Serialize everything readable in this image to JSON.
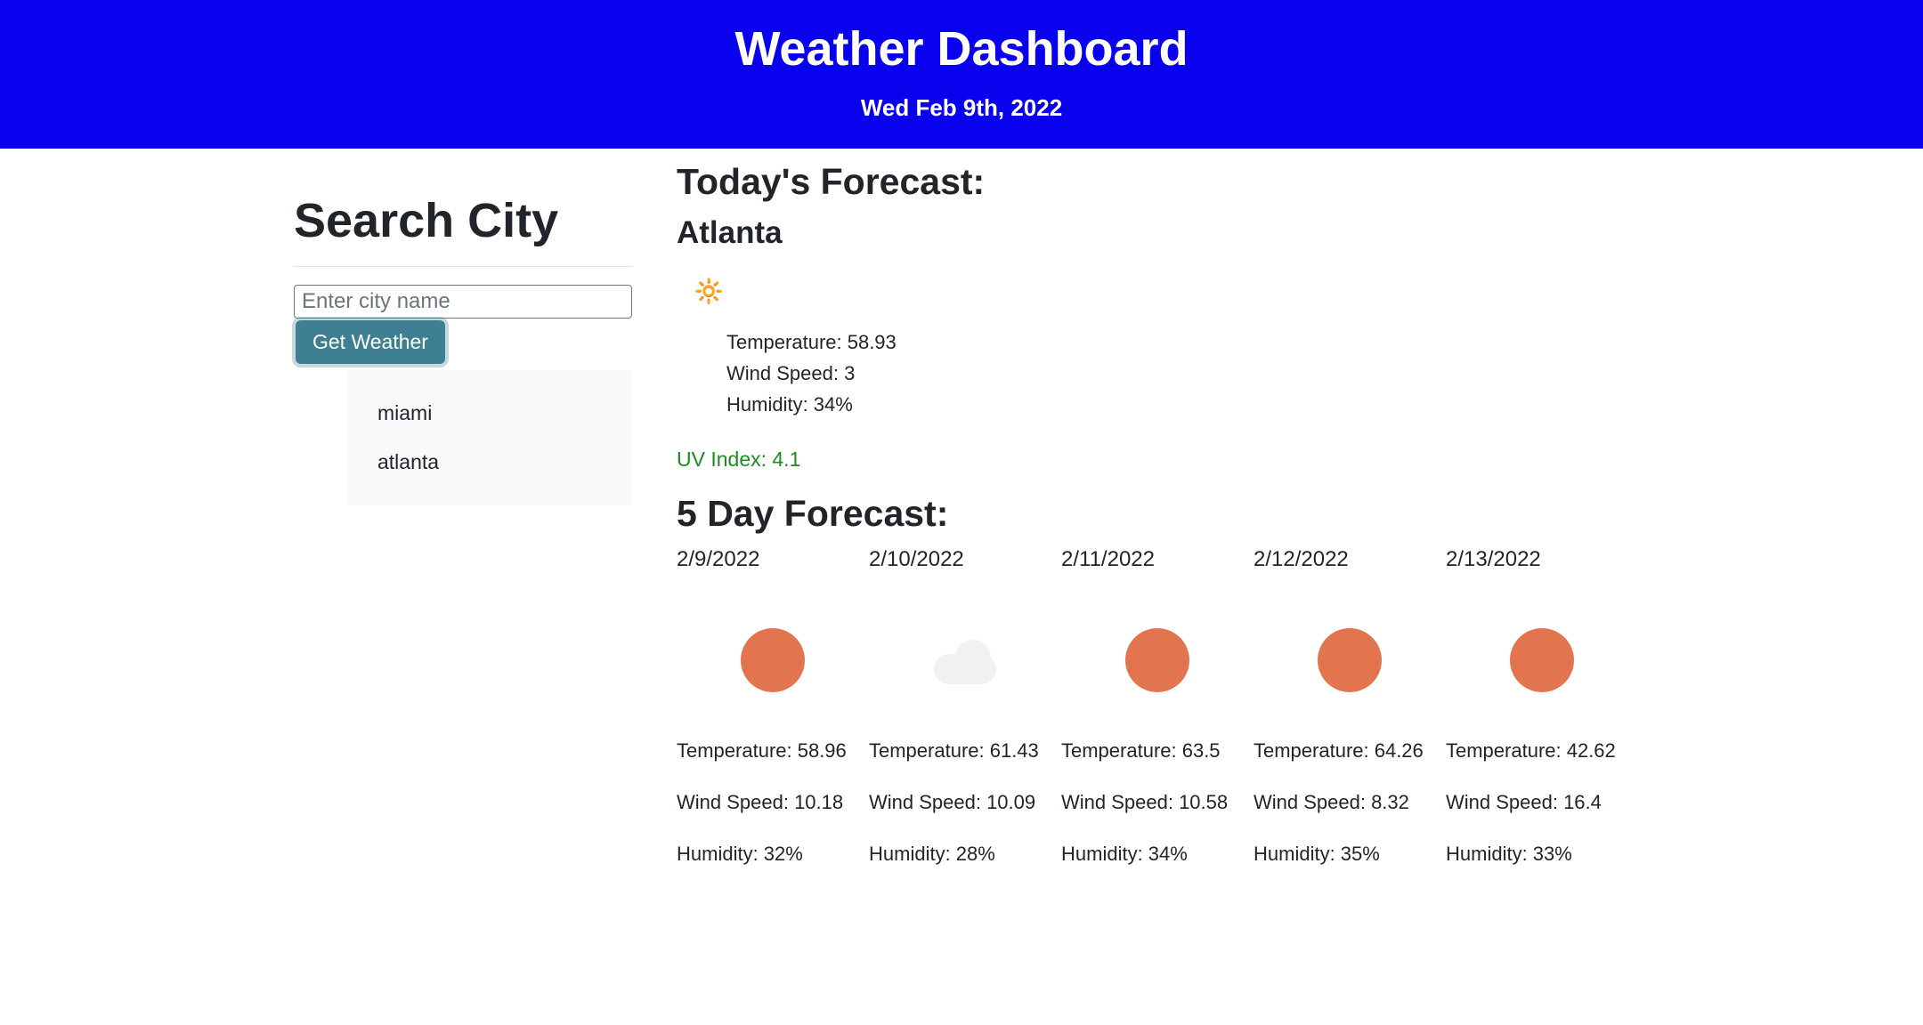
{
  "header": {
    "title": "Weather Dashboard",
    "date": "Wed Feb 9th, 2022"
  },
  "sidebar": {
    "title": "Search City",
    "search_placeholder": "Enter city name",
    "get_weather_label": "Get Weather",
    "history": [
      "miami",
      "atlanta"
    ]
  },
  "today": {
    "title": "Today's Forecast:",
    "city": "Atlanta",
    "icon": "sun-icon",
    "icon_glyph": "🔆",
    "temperature_label": "Temperature: 58.93",
    "wind_label": "Wind Speed: 3",
    "humidity_label": "Humidity: 34%",
    "uv_label": "UV Index: 4.1"
  },
  "forecast": {
    "title": "5 Day Forecast:",
    "days": [
      {
        "date": "2/9/2022",
        "icon": "sun",
        "temp": "Temperature: 58.96",
        "wind": "Wind Speed: 10.18",
        "humidity": "Humidity: 32%"
      },
      {
        "date": "2/10/2022",
        "icon": "cloud",
        "temp": "Temperature: 61.43",
        "wind": "Wind Speed: 10.09",
        "humidity": "Humidity: 28%"
      },
      {
        "date": "2/11/2022",
        "icon": "sun",
        "temp": "Temperature: 63.5",
        "wind": "Wind Speed: 10.58",
        "humidity": "Humidity: 34%"
      },
      {
        "date": "2/12/2022",
        "icon": "sun",
        "temp": "Temperature: 64.26",
        "wind": "Wind Speed: 8.32",
        "humidity": "Humidity: 35%"
      },
      {
        "date": "2/13/2022",
        "icon": "sun",
        "temp": "Temperature: 42.62",
        "wind": "Wind Speed: 16.4",
        "humidity": "Humidity: 33%"
      }
    ]
  }
}
